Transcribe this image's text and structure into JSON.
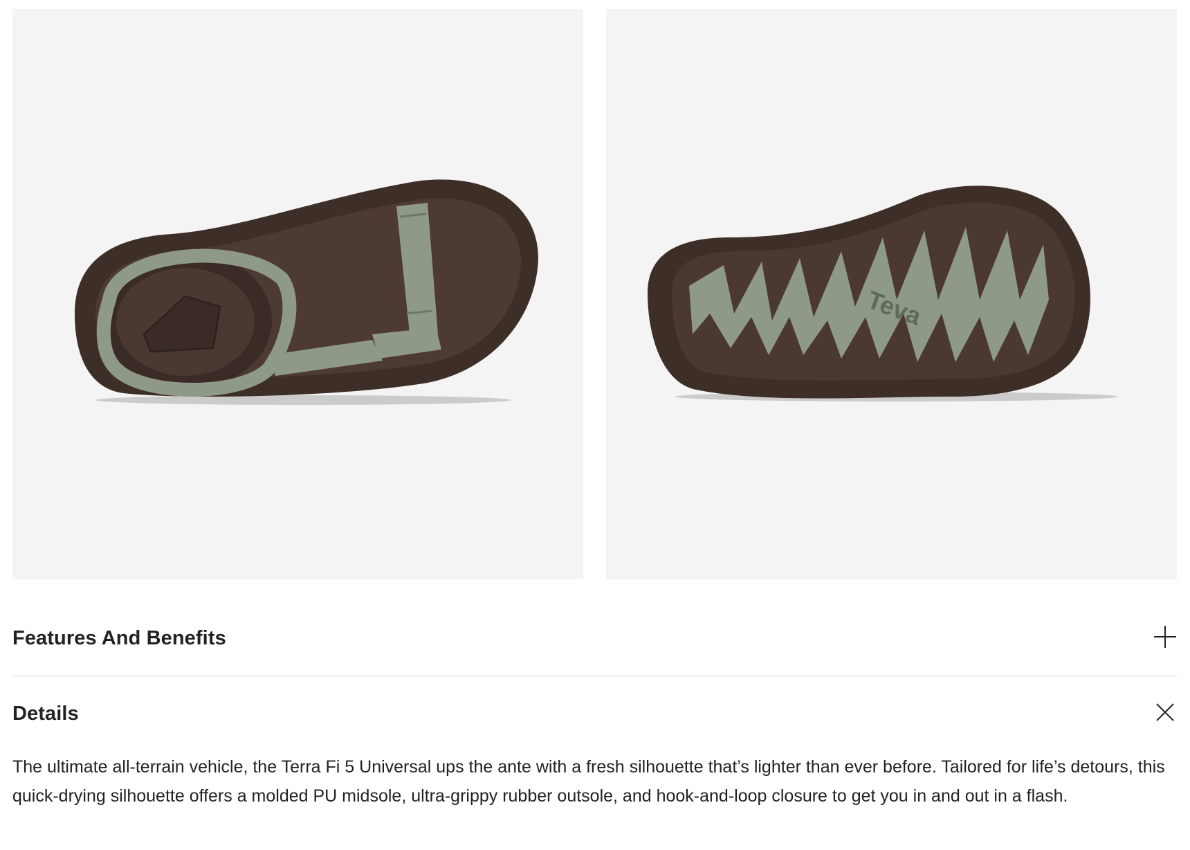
{
  "gallery": {
    "images": [
      {
        "alt": "Sandal top view"
      },
      {
        "alt": "Sandal outsole view",
        "outsole_logo": "Teva"
      }
    ]
  },
  "accordion": {
    "sections": [
      {
        "title": "Features And Benefits",
        "icon": "plus-icon",
        "expanded": false
      },
      {
        "title": "Details",
        "icon": "close-icon",
        "expanded": true,
        "body": "The ultimate all-terrain vehicle, the Terra Fi 5 Universal ups the ante with a fresh silhouette that’s lighter than ever before. Tailored for life’s detours, this quick-drying silhouette offers a molded PU midsole, ultra-grippy rubber outsole, and hook-and-loop closure to get you in and out in a flash."
      }
    ]
  },
  "colors": {
    "tile_background": "#f4f4f4",
    "sole_brown": "#3e2e28",
    "strap_sage": "#8f9987",
    "divider": "#dcdcdc",
    "text": "#222222"
  }
}
